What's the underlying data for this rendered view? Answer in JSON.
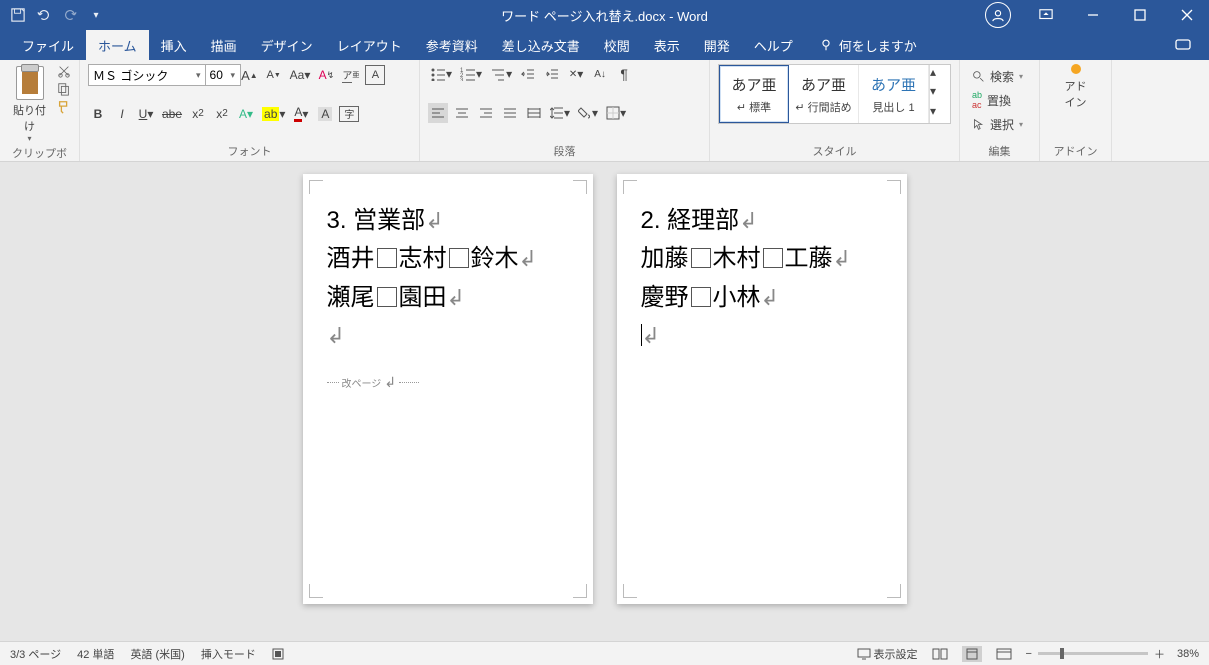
{
  "title": "ワード ページ入れ替え.docx  -  Word",
  "tabs": {
    "file": "ファイル",
    "home": "ホーム",
    "insert": "挿入",
    "draw": "描画",
    "design": "デザイン",
    "layout": "レイアウト",
    "references": "参考資料",
    "mailings": "差し込み文書",
    "review": "校閲",
    "view": "表示",
    "developer": "開発",
    "help": "ヘルプ",
    "tellme": "何をしますか"
  },
  "ribbon": {
    "clipboard": {
      "label": "クリップボード",
      "paste": "貼り付け"
    },
    "font": {
      "label": "フォント",
      "name": "ＭＳ ゴシック",
      "size": "60"
    },
    "paragraph": {
      "label": "段落"
    },
    "styles": {
      "label": "スタイル",
      "items": [
        {
          "preview": "あア亜",
          "name": "↵ 標準"
        },
        {
          "preview": "あア亜",
          "name": "↵ 行間詰め"
        },
        {
          "preview": "あア亜",
          "name": "見出し 1"
        }
      ]
    },
    "editing": {
      "label": "編集",
      "find": "検索",
      "replace": "置換",
      "select": "選択"
    },
    "addin": {
      "label": "アドイン",
      "button": "アド\nイン"
    }
  },
  "pages": [
    {
      "lines": [
        "3. 営業部",
        "酒井□志村□鈴木",
        "瀬尾□園田",
        ""
      ],
      "pagebreak": "改ページ"
    },
    {
      "lines": [
        "2. 経理部",
        "加藤□木村□工藤",
        "慶野□小林",
        ""
      ],
      "cursor": true
    }
  ],
  "status": {
    "page": "3/3 ページ",
    "words": "42 単語",
    "lang": "英語 (米国)",
    "mode": "挿入モード",
    "display": "表示設定",
    "zoom": "38%"
  }
}
